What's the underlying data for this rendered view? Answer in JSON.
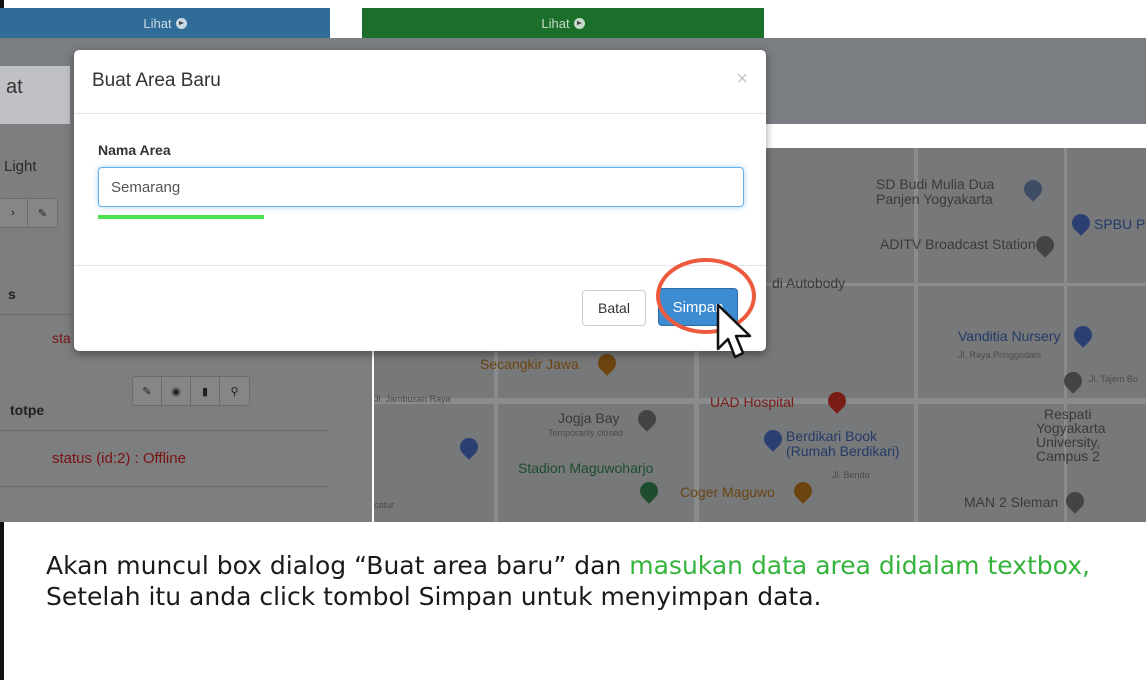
{
  "header": {
    "lihat_blue": "Lihat",
    "lihat_green": "Lihat",
    "tab_fragment": "at"
  },
  "left_panel": {
    "light_label": "Light",
    "row1_fragment": "s",
    "row1_status_fragment": "sta",
    "row2_name_fragment": "totpe",
    "row2_status": "status (id:2) : Offline"
  },
  "map": {
    "labels": {
      "sd_budi_1": "SD Budi Mulia Dua",
      "sd_budi_2": "Panjen Yogyakarta",
      "spbu": "SPBU P",
      "aditv": "ADITV Broadcast Station",
      "autobody": "di Autobody",
      "vanditia": "Vanditia Nursery",
      "jl_raya_pringgodani": "Jl. Raya Pringgodani",
      "jl_tajem": "Jl. Tajem Bo",
      "secangkir": "Secangkir Jawa",
      "uad": "UAD Hospital",
      "respati_1": "Respati",
      "respati_2": "Yogyakarta",
      "respati_3": "University,",
      "respati_4": "Campus 2",
      "jogja_bay": "Jogja Bay",
      "temporarily_closed": "Temporarily closed",
      "berdikari_1": "Berdikari Book",
      "berdikari_2": "(Rumah Berdikari)",
      "jl_bendo": "Jl. Bendo",
      "stadion": "Stadion Maguwoharjo",
      "coger": "Coger Maguwo",
      "man2": "MAN 2 Sleman",
      "jl_jambusan": "Jl. Jambusan Raya",
      "catur": "catur"
    }
  },
  "modal": {
    "title": "Buat Area Baru",
    "close": "×",
    "field_label": "Nama Area",
    "field_value": "Semarang",
    "batal": "Batal",
    "simpan": "Simpan"
  },
  "caption": {
    "part1": "Akan muncul box dialog “Buat area baru” dan ",
    "part2_highlight": "masukan data area didalam textbox,",
    "part3": " Setelah itu anda click tombol Simpan untuk menyimpan data."
  },
  "colors": {
    "lihat_blue": "#2f6c97",
    "lihat_green": "#1b6f2a",
    "primary_button": "#3d8bd0",
    "highlight_circle": "#ee5a3e",
    "caption_highlight": "#35b33d",
    "underline_green": "#4ce34c"
  }
}
